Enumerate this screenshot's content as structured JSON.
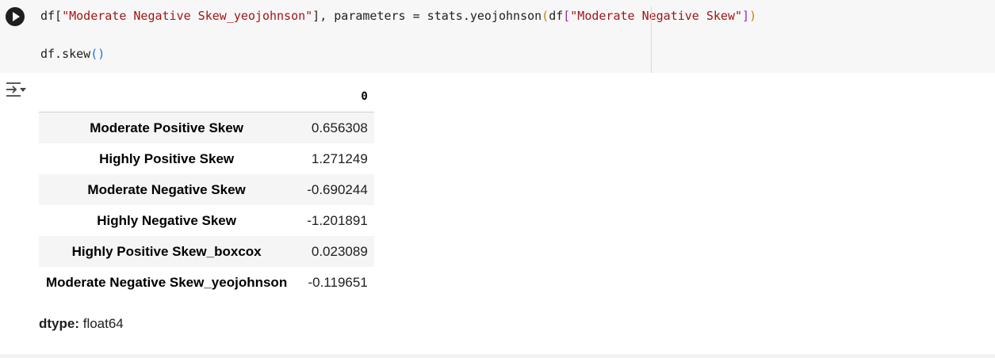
{
  "code": {
    "line1": {
      "t1": "df[",
      "t2": "\"Moderate Negative Skew_yeojohnson\"",
      "t3": "], parameters = stats.yeojohnson",
      "t4": "(",
      "t5": "df",
      "t6": "[",
      "t7": "\"Moderate Negative Skew\"",
      "t8": "]",
      "t9": ")"
    },
    "line2": {
      "t1": "df.skew",
      "t2": "()"
    }
  },
  "output": {
    "column_header": "0",
    "rows": [
      {
        "label": "Moderate Positive Skew",
        "value": "0.656308"
      },
      {
        "label": "Highly Positive Skew",
        "value": "1.271249"
      },
      {
        "label": "Moderate Negative Skew",
        "value": "-0.690244"
      },
      {
        "label": "Highly Negative Skew",
        "value": "-1.201891"
      },
      {
        "label": "Highly Positive Skew_boxcox",
        "value": "0.023089"
      },
      {
        "label": "Moderate Negative Skew_yeojohnson",
        "value": "-0.119651"
      }
    ],
    "dtype_label": "dtype:",
    "dtype_value": " float64"
  },
  "icons": {
    "run": "play-icon",
    "output_toggle": "output-collapse-icon"
  },
  "colors": {
    "string": "#a31515",
    "bracket_level1": "#b8860b",
    "bracket_level2": "#9c27b0",
    "bracket_level3": "#1a73e8",
    "cell_background": "#f7f7f7"
  }
}
